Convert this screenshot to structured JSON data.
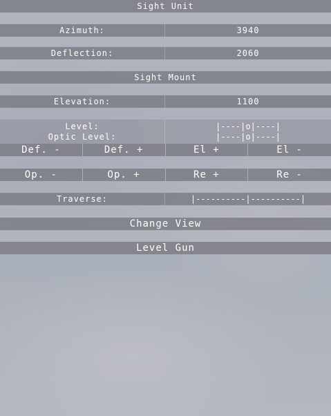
{
  "sight_unit": {
    "header": "Sight Unit",
    "azimuth_label": "Azimuth:",
    "azimuth_value": "3940",
    "deflection_label": "Deflection:",
    "deflection_value": "2060"
  },
  "sight_mount": {
    "header": "Sight Mount",
    "elevation_label": "Elevation:",
    "elevation_value": "1100",
    "level_label": "Level:",
    "level_gauge": "|----|o|----|",
    "optic_level_label": "Optic Level:",
    "optic_level_gauge": "|----|o|----|"
  },
  "buttons_row1": [
    "Def. -",
    "Def. +",
    "El +",
    "El -"
  ],
  "buttons_row2": [
    "Op. -",
    "Op. +",
    "Re +",
    "Re -"
  ],
  "traverse": {
    "label": "Traverse:",
    "gauge": "|----------|----------|"
  },
  "change_view_label": "Change View",
  "level_gun_label": "Level Gun"
}
